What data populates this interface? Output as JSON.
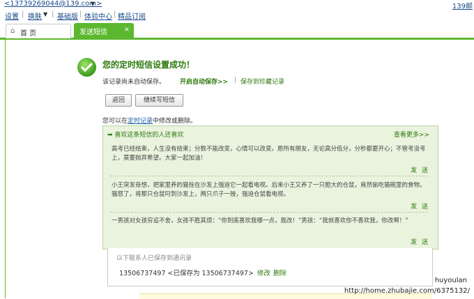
{
  "top": {
    "account": "<13739269044@139.com>",
    "phone_right": "139邮"
  },
  "menu": {
    "settings": "设置",
    "skin": "换肤",
    "basic": "基础版",
    "experience": "体验中心",
    "subscribe": "精品订阅"
  },
  "tabs": {
    "home": "首 页",
    "sms": "发送短信",
    "close": "×"
  },
  "result": {
    "title": "您的定时短信设置成功！",
    "notice": "该记录尚未自动保存。",
    "autosave": "开启自动保存>>",
    "save_treasure": "保存到珍藏记录"
  },
  "buttons": {
    "back": "返回",
    "continue": "继续写短信"
  },
  "hint": {
    "prefix": "您可以在",
    "link": "定时记录",
    "suffix": "中修改或删除。"
  },
  "panel": {
    "heading": "➡ 喜欢这条短信的人还喜欢",
    "more": "查看更多>>",
    "messages": [
      {
        "text": "高考已经结束，人生没有结束；分数不能改变，心情可以改变。愿所有朋友，无论高分低分，分秒都要开心；不管考没考上，莫要抛弃希望。大家一起加油！",
        "send": "发 送"
      },
      {
        "text": "小王突发奇想，把家里养的猫拴在沙发上强迫它一起看电视。后来小王又养了一只胆大的仓鼠，竟然偷吃猫碗里的食物。猫怒了，将那只仓鼠叼到沙发上，两只爪子一按，强迫仓鼠看电视。",
        "send": "发 送"
      },
      {
        "text": "一男孩对女孩穷追不舍，女孩不胜其烦：“你到底喜欢我哪一点，我改！”男孩：“我就喜欢你不喜欢我，你改啊！”",
        "send": "发 送"
      }
    ]
  },
  "contacts": {
    "title": "以下联系人已保存到通讯录",
    "entry": "13506737497 <已保存为 13506737497>",
    "edit": "修改",
    "delete": "删除"
  },
  "watermark": {
    "name": "huyoulan",
    "url": "http://home.zhubajie.com/6375132/"
  }
}
